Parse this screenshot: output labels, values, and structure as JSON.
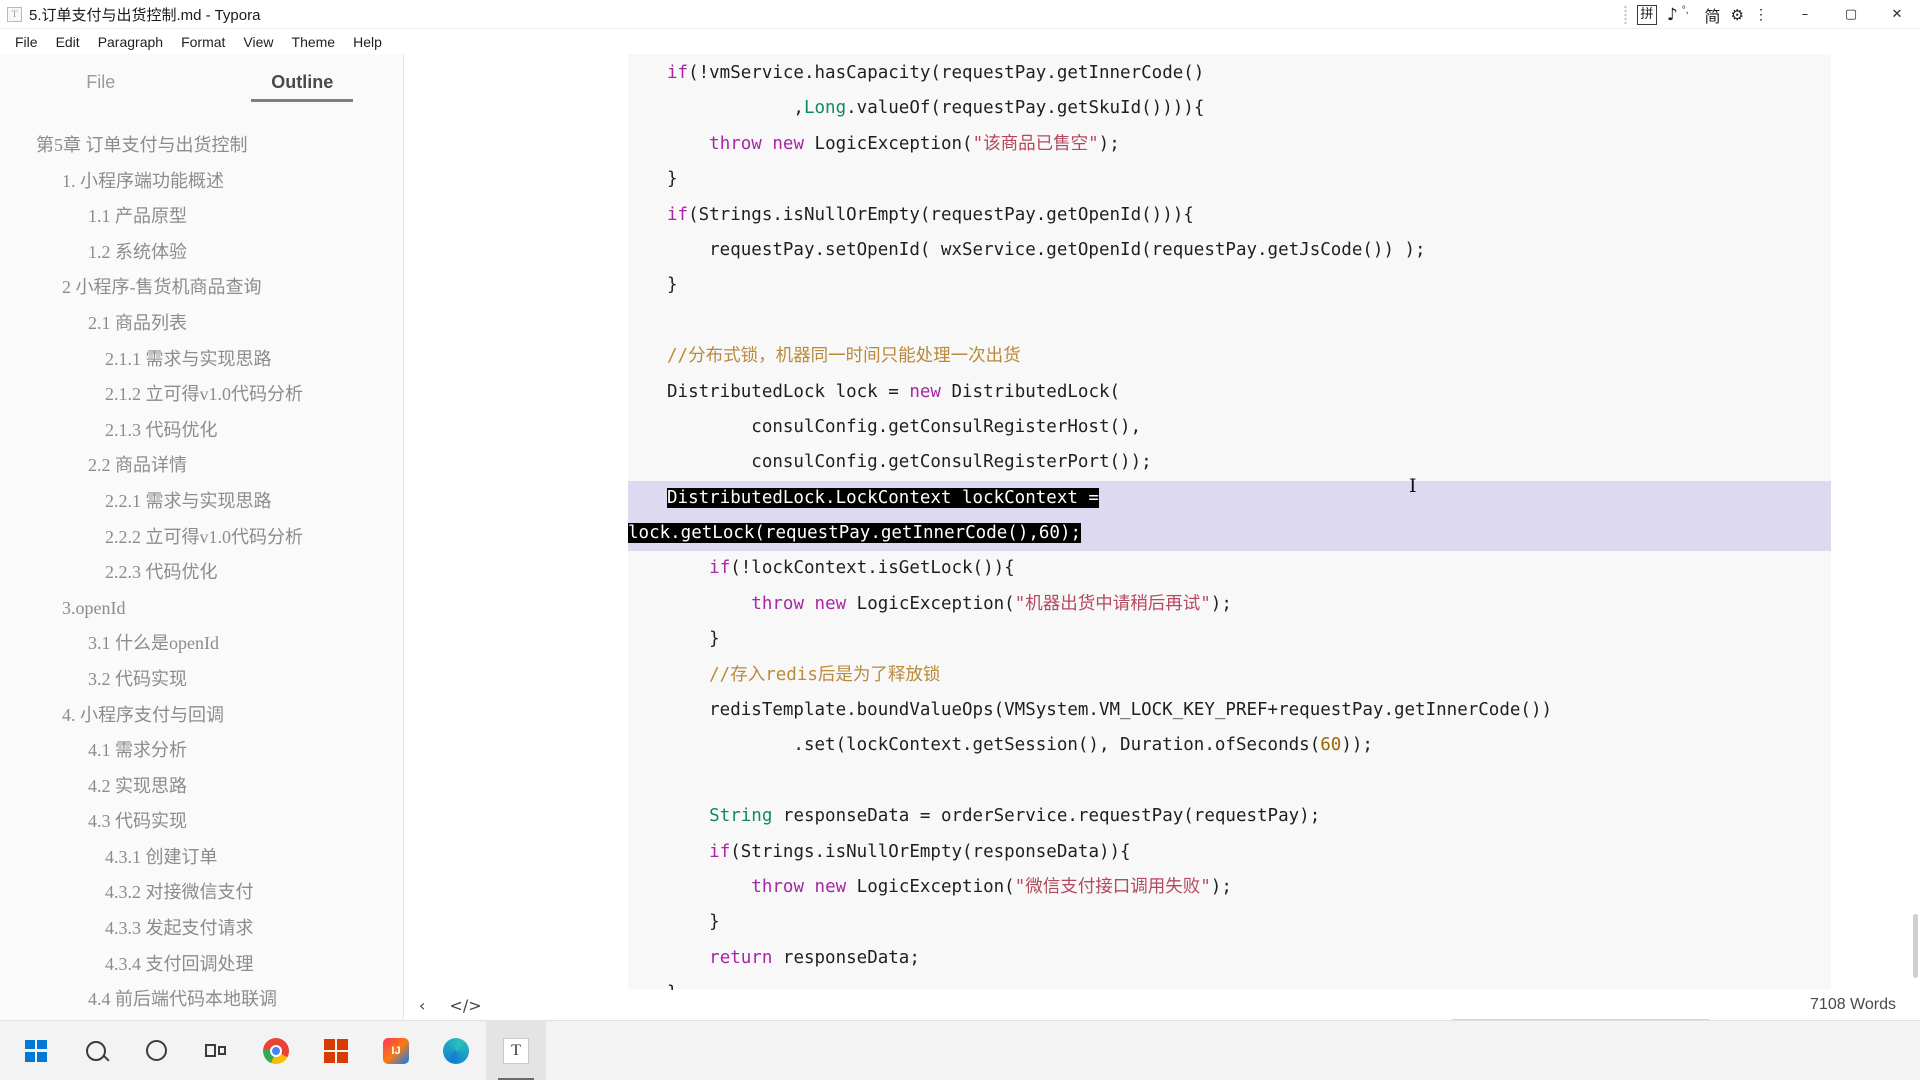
{
  "window": {
    "title": "5.订单支付与出货控制.md - Typora",
    "app_icon": "T",
    "minimize": "–",
    "maximize": "▢",
    "close": "✕"
  },
  "ime_tray": {
    "pinyin_box": "拼",
    "note_icon": "♪",
    "superscript": "°,",
    "han_icon": "简",
    "gear_icon": "⚙",
    "more_icon": "⋮"
  },
  "menu": {
    "items": [
      "File",
      "Edit",
      "Paragraph",
      "Format",
      "View",
      "Theme",
      "Help"
    ]
  },
  "sidebar": {
    "tabs": [
      {
        "label": "File",
        "active": false
      },
      {
        "label": "Outline",
        "active": true
      }
    ],
    "outline": [
      {
        "label": "第5章 订单支付与出货控制",
        "level": 1
      },
      {
        "label": "1. 小程序端功能概述",
        "level": 2
      },
      {
        "label": "1.1 产品原型",
        "level": 3
      },
      {
        "label": "1.2 系统体验",
        "level": 3
      },
      {
        "label": "2 小程序-售货机商品查询",
        "level": 2
      },
      {
        "label": "2.1 商品列表",
        "level": 3
      },
      {
        "label": "2.1.1 需求与实现思路",
        "level": 4
      },
      {
        "label": "2.1.2 立可得v1.0代码分析",
        "level": 4
      },
      {
        "label": "2.1.3 代码优化",
        "level": 4
      },
      {
        "label": "2.2 商品详情",
        "level": 3
      },
      {
        "label": "2.2.1 需求与实现思路",
        "level": 4
      },
      {
        "label": "2.2.2 立可得v1.0代码分析",
        "level": 4
      },
      {
        "label": "2.2.3 代码优化",
        "level": 4
      },
      {
        "label": "3.openId",
        "level": 2
      },
      {
        "label": "3.1 什么是openId",
        "level": 3
      },
      {
        "label": "3.2 代码实现",
        "level": 3
      },
      {
        "label": "4. 小程序支付与回调",
        "level": 2
      },
      {
        "label": "4.1 需求分析",
        "level": 3
      },
      {
        "label": "4.2 实现思路",
        "level": 3
      },
      {
        "label": "4.3 代码实现",
        "level": 3
      },
      {
        "label": "4.3.1 创建订单",
        "level": 4
      },
      {
        "label": "4.3.2 对接微信支付",
        "level": 4
      },
      {
        "label": "4.3.3 发起支付请求",
        "level": 4
      },
      {
        "label": "4.3.4 支付回调处理",
        "level": 4
      },
      {
        "label": "4.4 前后端代码本地联调",
        "level": 3
      }
    ]
  },
  "editor": {
    "code_lines": [
      {
        "indent": 0,
        "selected": false,
        "tokens": [
          {
            "t": "if",
            "c": "kw"
          },
          {
            "t": "(!vmService.hasCapacity(requestPay.getInnerCode()",
            "c": "plain"
          }
        ]
      },
      {
        "indent": 0,
        "selected": false,
        "tokens": [
          {
            "t": "            ,",
            "c": "plain"
          },
          {
            "t": "Long",
            "c": "type"
          },
          {
            "t": ".valueOf(requestPay.getSkuId())))",
            "c": "plain"
          },
          {
            "t": "{",
            "c": "plain"
          }
        ]
      },
      {
        "indent": 0,
        "selected": false,
        "tokens": [
          {
            "t": "    ",
            "c": "plain"
          },
          {
            "t": "throw",
            "c": "kw"
          },
          {
            "t": " ",
            "c": "plain"
          },
          {
            "t": "new",
            "c": "kw"
          },
          {
            "t": " LogicException(",
            "c": "plain"
          },
          {
            "t": "\"该商品已售空\"",
            "c": "str"
          },
          {
            "t": ");",
            "c": "plain"
          }
        ]
      },
      {
        "indent": 0,
        "selected": false,
        "tokens": [
          {
            "t": "}",
            "c": "plain"
          }
        ]
      },
      {
        "indent": 0,
        "selected": false,
        "tokens": [
          {
            "t": "if",
            "c": "kw"
          },
          {
            "t": "(Strings.isNullOrEmpty(requestPay.getOpenId())){",
            "c": "plain"
          }
        ]
      },
      {
        "indent": 0,
        "selected": false,
        "tokens": [
          {
            "t": "    requestPay.setOpenId( wxService.getOpenId(requestPay.getJsCode()) );",
            "c": "plain"
          }
        ]
      },
      {
        "indent": 0,
        "selected": false,
        "tokens": [
          {
            "t": "}",
            "c": "plain"
          }
        ]
      },
      {
        "indent": 0,
        "selected": false,
        "tokens": [
          {
            "t": "",
            "c": "plain"
          }
        ]
      },
      {
        "indent": 0,
        "selected": false,
        "tokens": [
          {
            "t": "//分布式锁，机器同一时间只能处理一次出货",
            "c": "com"
          }
        ]
      },
      {
        "indent": 0,
        "selected": false,
        "tokens": [
          {
            "t": "DistributedLock lock = ",
            "c": "plain"
          },
          {
            "t": "new",
            "c": "kw"
          },
          {
            "t": " DistributedLock(",
            "c": "plain"
          }
        ]
      },
      {
        "indent": 0,
        "selected": false,
        "tokens": [
          {
            "t": "        consulConfig.getConsulRegisterHost(),",
            "c": "plain"
          }
        ]
      },
      {
        "indent": 0,
        "selected": false,
        "tokens": [
          {
            "t": "        consulConfig.getConsulRegisterPort());",
            "c": "plain"
          }
        ]
      },
      {
        "indent": 0,
        "selected": true,
        "sel_start": 0,
        "tokens": [
          {
            "t": "DistributedLock.LockContext lockContext =",
            "c": "plain",
            "sel": true
          }
        ]
      },
      {
        "indent": 0,
        "selected": true,
        "full_left": true,
        "tokens": [
          {
            "t": "lock.getLock(requestPay.getInnerCode(),60);",
            "c": "plain",
            "sel": true
          }
        ]
      },
      {
        "indent": 0,
        "selected": false,
        "tokens": [
          {
            "t": "    ",
            "c": "plain"
          },
          {
            "t": "if",
            "c": "kw"
          },
          {
            "t": "(!lockContext.isGetLock()){",
            "c": "plain"
          }
        ]
      },
      {
        "indent": 0,
        "selected": false,
        "tokens": [
          {
            "t": "        ",
            "c": "plain"
          },
          {
            "t": "throw",
            "c": "kw"
          },
          {
            "t": " ",
            "c": "plain"
          },
          {
            "t": "new",
            "c": "kw"
          },
          {
            "t": " LogicException(",
            "c": "plain"
          },
          {
            "t": "\"机器出货中请稍后再试\"",
            "c": "str"
          },
          {
            "t": ");",
            "c": "plain"
          }
        ]
      },
      {
        "indent": 0,
        "selected": false,
        "tokens": [
          {
            "t": "    }",
            "c": "plain"
          }
        ]
      },
      {
        "indent": 0,
        "selected": false,
        "tokens": [
          {
            "t": "    //存入redis后是为了释放锁",
            "c": "com"
          }
        ]
      },
      {
        "indent": 0,
        "selected": false,
        "tokens": [
          {
            "t": "    redisTemplate.boundValueOps(VMSystem.VM_LOCK_KEY_PREF+requestPay.getInnerCode())",
            "c": "plain"
          }
        ]
      },
      {
        "indent": 0,
        "selected": false,
        "tokens": [
          {
            "t": "            .set(lockContext.getSession(), Duration.ofSeconds(",
            "c": "plain"
          },
          {
            "t": "60",
            "c": "num"
          },
          {
            "t": "));",
            "c": "plain"
          }
        ]
      },
      {
        "indent": 0,
        "selected": false,
        "tokens": [
          {
            "t": "",
            "c": "plain"
          }
        ]
      },
      {
        "indent": 0,
        "selected": false,
        "tokens": [
          {
            "t": "    ",
            "c": "plain"
          },
          {
            "t": "String",
            "c": "type"
          },
          {
            "t": " responseData = orderService.requestPay(requestPay);",
            "c": "plain"
          }
        ]
      },
      {
        "indent": 0,
        "selected": false,
        "tokens": [
          {
            "t": "    ",
            "c": "plain"
          },
          {
            "t": "if",
            "c": "kw"
          },
          {
            "t": "(Strings.isNullOrEmpty(responseData)){",
            "c": "plain"
          }
        ]
      },
      {
        "indent": 0,
        "selected": false,
        "tokens": [
          {
            "t": "        ",
            "c": "plain"
          },
          {
            "t": "throw",
            "c": "kw"
          },
          {
            "t": " ",
            "c": "plain"
          },
          {
            "t": "new",
            "c": "kw"
          },
          {
            "t": " LogicException(",
            "c": "plain"
          },
          {
            "t": "\"微信支付接口调用失败\"",
            "c": "str"
          },
          {
            "t": ");",
            "c": "plain"
          }
        ]
      },
      {
        "indent": 0,
        "selected": false,
        "tokens": [
          {
            "t": "    }",
            "c": "plain"
          }
        ]
      },
      {
        "indent": 0,
        "selected": false,
        "tokens": [
          {
            "t": "    ",
            "c": "plain"
          },
          {
            "t": "return",
            "c": "kw"
          },
          {
            "t": " responseData;",
            "c": "plain"
          }
        ]
      },
      {
        "indent": 0,
        "selected": false,
        "tokens": [
          {
            "t": "}",
            "c": "plain"
          }
        ]
      }
    ]
  },
  "statusbar": {
    "prev_icon": "‹",
    "source_icon": "</>",
    "word_count": "7108 Words"
  },
  "taskbar": {
    "items": [
      {
        "name": "start",
        "label": ""
      },
      {
        "name": "search",
        "label": ""
      },
      {
        "name": "cortana",
        "label": ""
      },
      {
        "name": "task-view",
        "label": ""
      },
      {
        "name": "chrome",
        "label": ""
      },
      {
        "name": "store",
        "label": ""
      },
      {
        "name": "intellij-idea",
        "label": "IJ"
      },
      {
        "name": "edge",
        "label": ""
      },
      {
        "name": "typora",
        "label": "T"
      }
    ]
  }
}
